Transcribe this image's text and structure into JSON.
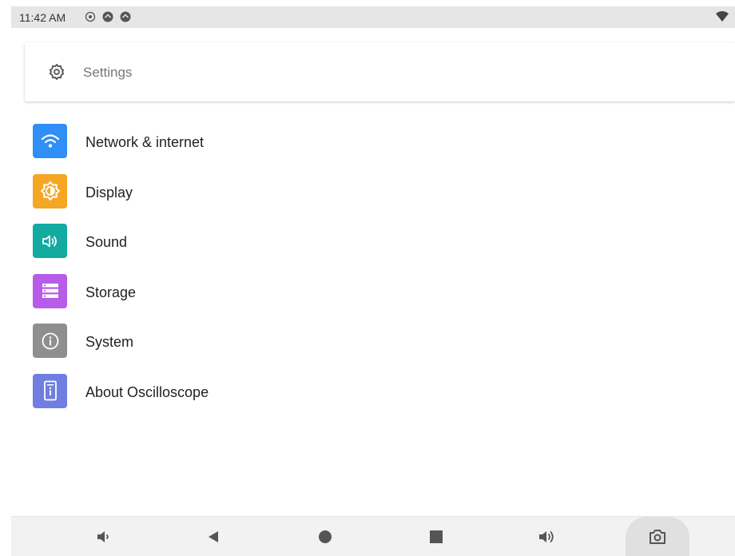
{
  "status_bar": {
    "time": "11:42 AM",
    "icons": [
      "record-icon",
      "notification-icon",
      "notification-icon"
    ],
    "right_icon": "wifi-icon"
  },
  "search": {
    "icon": "gear-icon",
    "placeholder": "Settings"
  },
  "menu": {
    "items": [
      {
        "label": "Network & internet",
        "icon": "wifi-icon",
        "color": "#2f8ff5"
      },
      {
        "label": "Display",
        "icon": "brightness-icon",
        "color": "#f5a623"
      },
      {
        "label": "Sound",
        "icon": "speaker-icon",
        "color": "#13aaa0"
      },
      {
        "label": "Storage",
        "icon": "storage-icon",
        "color": "#b75ce8"
      },
      {
        "label": "System",
        "icon": "info-icon",
        "color": "#8f8f8f"
      },
      {
        "label": "About Oscilloscope",
        "icon": "device-icon",
        "color": "#6f7ee0"
      }
    ]
  },
  "nav_bar": {
    "buttons": [
      "volume-down-icon",
      "back-icon",
      "home-icon",
      "recents-icon",
      "volume-up-icon",
      "camera-icon"
    ]
  },
  "colors": {
    "status_bar_bg": "#e6e6e6",
    "nav_bar_bg": "#f2f2f2",
    "text": "#222222"
  }
}
